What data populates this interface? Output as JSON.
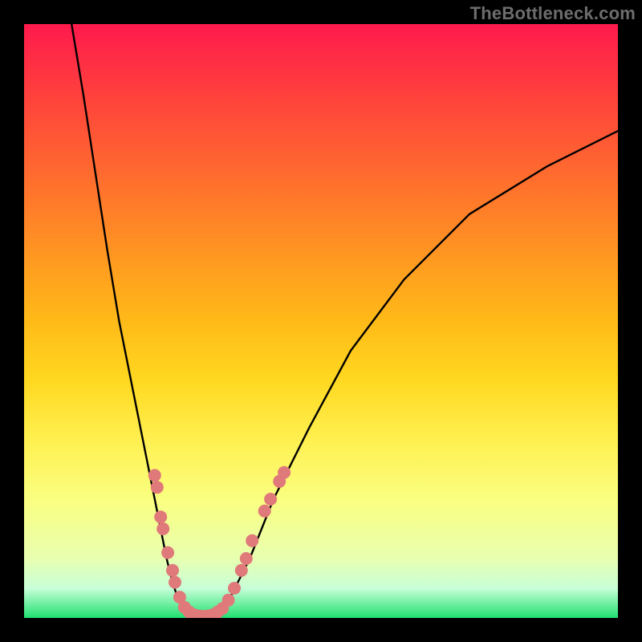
{
  "watermark": "TheBottleneck.com",
  "colors": {
    "frame": "#000000",
    "curve": "#000000",
    "marker_fill": "#e07a7a",
    "marker_stroke": "#c96a6a"
  },
  "chart_data": {
    "type": "line",
    "title": "",
    "xlabel": "",
    "ylabel": "",
    "xlim": [
      0,
      100
    ],
    "ylim": [
      0,
      100
    ],
    "series": [
      {
        "name": "left-branch",
        "x": [
          8,
          10,
          12,
          14,
          16,
          18,
          20,
          22,
          23,
          24,
          25,
          26,
          27
        ],
        "y": [
          100,
          88,
          75,
          62,
          50,
          40,
          30,
          20,
          15,
          10,
          6,
          3,
          1
        ]
      },
      {
        "name": "valley",
        "x": [
          27,
          28,
          29,
          30,
          31,
          32,
          33
        ],
        "y": [
          1,
          0.3,
          0.1,
          0.0,
          0.1,
          0.3,
          1
        ]
      },
      {
        "name": "right-branch",
        "x": [
          33,
          35,
          38,
          42,
          48,
          55,
          64,
          75,
          88,
          100
        ],
        "y": [
          1,
          4,
          10,
          20,
          32,
          45,
          57,
          68,
          76,
          82
        ]
      }
    ],
    "markers": [
      {
        "x": 22.0,
        "y": 24
      },
      {
        "x": 22.4,
        "y": 22
      },
      {
        "x": 23.0,
        "y": 17
      },
      {
        "x": 23.4,
        "y": 15
      },
      {
        "x": 24.2,
        "y": 11
      },
      {
        "x": 25.0,
        "y": 8
      },
      {
        "x": 25.4,
        "y": 6
      },
      {
        "x": 26.2,
        "y": 3.5
      },
      {
        "x": 27.0,
        "y": 1.8
      },
      {
        "x": 27.8,
        "y": 1.0
      },
      {
        "x": 28.4,
        "y": 0.6
      },
      {
        "x": 29.0,
        "y": 0.4
      },
      {
        "x": 29.6,
        "y": 0.3
      },
      {
        "x": 30.2,
        "y": 0.25
      },
      {
        "x": 30.8,
        "y": 0.3
      },
      {
        "x": 31.4,
        "y": 0.4
      },
      {
        "x": 32.0,
        "y": 0.6
      },
      {
        "x": 32.6,
        "y": 1.0
      },
      {
        "x": 33.4,
        "y": 1.6
      },
      {
        "x": 34.4,
        "y": 3.0
      },
      {
        "x": 35.4,
        "y": 5.0
      },
      {
        "x": 36.6,
        "y": 8.0
      },
      {
        "x": 37.4,
        "y": 10.0
      },
      {
        "x": 38.4,
        "y": 13.0
      },
      {
        "x": 40.5,
        "y": 18.0
      },
      {
        "x": 41.5,
        "y": 20.0
      },
      {
        "x": 43.0,
        "y": 23.0
      },
      {
        "x": 43.8,
        "y": 24.5
      }
    ]
  }
}
